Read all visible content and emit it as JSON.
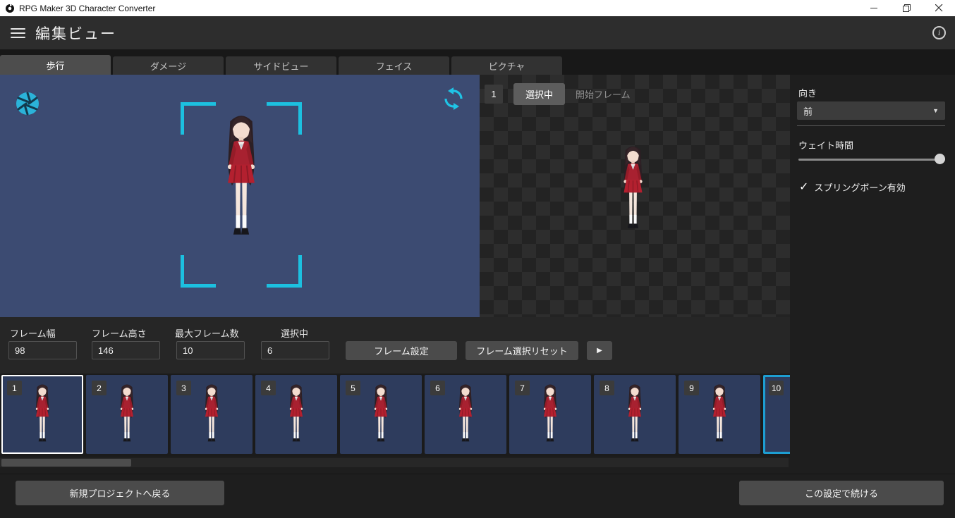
{
  "window": {
    "title": "RPG Maker 3D Character Converter"
  },
  "header": {
    "title": "編集ビュー",
    "info_glyph": "i"
  },
  "tabs": [
    {
      "label": "歩行",
      "active": true
    },
    {
      "label": "ダメージ",
      "active": false
    },
    {
      "label": "サイドビュー",
      "active": false
    },
    {
      "label": "フェイス",
      "active": false
    },
    {
      "label": "ピクチャ",
      "active": false
    }
  ],
  "sheet_header": {
    "frame_number": "1",
    "selected": "選択中",
    "start_frame": "開始フレーム"
  },
  "side_panel": {
    "direction_label": "向き",
    "direction_value": "前",
    "wait_time_label": "ウェイト時間",
    "spring_bone_label": "スプリングボーン有効",
    "spring_bone_checked": true,
    "check_glyph": "✓",
    "dropdown_arrow_glyph": "▼"
  },
  "frame_controls": {
    "width_label": "フレーム幅",
    "width_value": "98",
    "height_label": "フレーム高さ",
    "height_value": "146",
    "max_label": "最大フレーム数",
    "max_value": "10",
    "selected_label": "選択中",
    "selected_value": "6",
    "set_button": "フレーム設定",
    "reset_button": "フレーム選択リセット",
    "play_button": "▶"
  },
  "filmstrip": {
    "frames": [
      {
        "number": "1",
        "state": "selected"
      },
      {
        "number": "2",
        "state": "normal"
      },
      {
        "number": "3",
        "state": "normal"
      },
      {
        "number": "4",
        "state": "normal"
      },
      {
        "number": "5",
        "state": "normal"
      },
      {
        "number": "6",
        "state": "normal"
      },
      {
        "number": "7",
        "state": "normal"
      },
      {
        "number": "8",
        "state": "normal"
      },
      {
        "number": "9",
        "state": "normal"
      },
      {
        "number": "10",
        "state": "highlighted"
      }
    ]
  },
  "footer": {
    "back_button": "新規プロジェクトへ戻る",
    "continue_button": "この設定で続ける"
  },
  "colors": {
    "accent_cyan": "#1cc0e0",
    "preview_background": "#3c4b72",
    "thumbnail_background": "#2e3c5d",
    "selected_frame_border": "#ffffff",
    "highlight_frame_border": "#1d9ed2",
    "character_outfit_red": "#a82130"
  }
}
